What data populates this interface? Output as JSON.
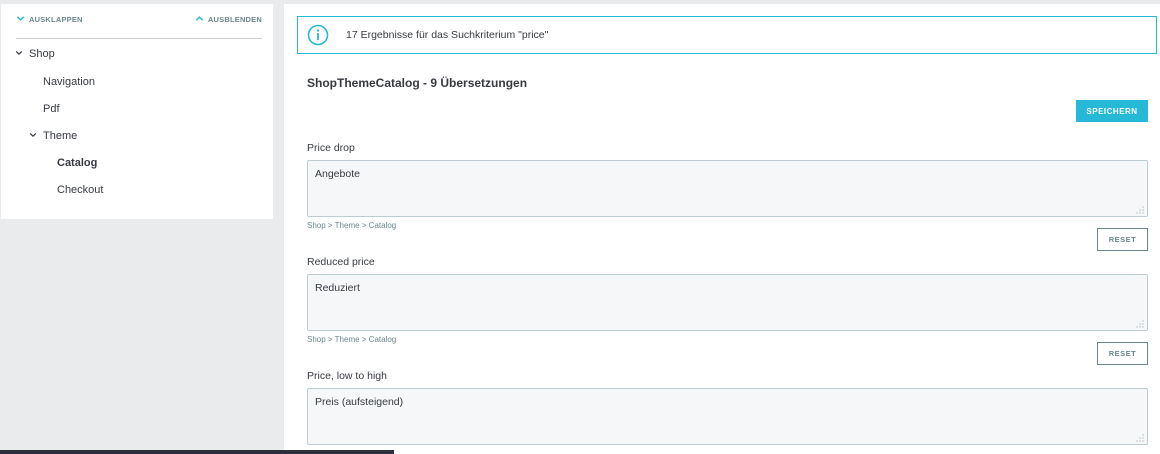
{
  "sidebar": {
    "expand_label": "AUSKLAPPEN",
    "collapse_label": "AUSBLENDEN",
    "tree": {
      "shop": "Shop",
      "navigation": "Navigation",
      "pdf": "Pdf",
      "theme": "Theme",
      "catalog": "Catalog",
      "checkout": "Checkout"
    }
  },
  "alert": {
    "text": "17 Ergebnisse für das Suchkriterium \"price\"",
    "icon": "info-icon"
  },
  "main": {
    "title": "ShopThemeCatalog - 9 Übersetzungen",
    "save_label": "SPEICHERN",
    "fields": [
      {
        "label": "Price drop",
        "value": "Angebote",
        "path": "Shop > Theme > Catalog",
        "reset_label": "RESET"
      },
      {
        "label": "Reduced price",
        "value": "Reduziert",
        "path": "Shop > Theme > Catalog",
        "reset_label": "RESET"
      },
      {
        "label": "Price, low to high",
        "value": "Preis (aufsteigend)"
      }
    ]
  },
  "colors": {
    "accent": "#25b9d7",
    "text": "#363a41",
    "muted": "#6c868e",
    "background": "#eaebec"
  }
}
